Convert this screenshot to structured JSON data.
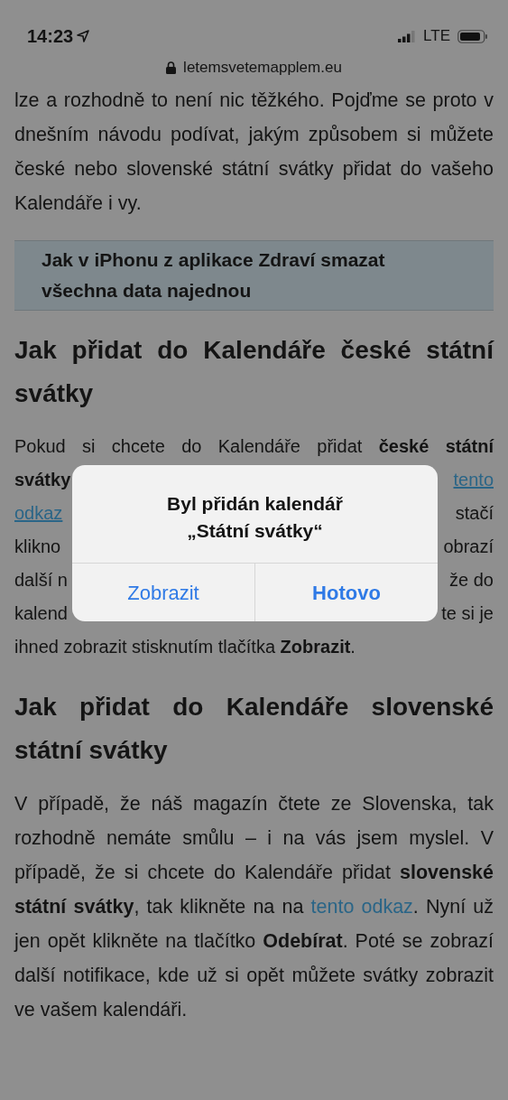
{
  "status_bar": {
    "time": "14:23",
    "network": "LTE"
  },
  "address_bar": {
    "url": "letemsvetemapplem.eu"
  },
  "article": {
    "intro": "lze a rozhodně to není nic těžkého. Pojďme se proto v dnešním návodu podívat, jakým způsobem si můžete české nebo slovenské státní svátky přidat do vašeho Kalendáře i vy.",
    "related_link": "Jak v iPhonu z aplikace Zdraví smazat všechna data najednou",
    "heading_1": "Jak přidat do Kalendáře české státní svátky",
    "covered_paragraph_lines": [
      {
        "left": [
          {
            "kind": "text",
            "text": "Pokud si chcete do Kalendáře přidat **české státní**"
          }
        ]
      },
      {
        "left": [
          {
            "kind": "text",
            "text": "**svátky**"
          }
        ],
        "right": [
          {
            "kind": "link",
            "text": "tento"
          }
        ]
      },
      {
        "left": [
          {
            "kind": "link",
            "text": "odkaz"
          }
        ],
        "right": [
          {
            "kind": "text",
            "text": "stačí"
          }
        ]
      },
      {
        "left": [
          {
            "kind": "text",
            "text": "klikno"
          }
        ],
        "right": [
          {
            "kind": "text",
            "text": "obrazí"
          }
        ]
      },
      {
        "left": [
          {
            "kind": "text",
            "text": "další n"
          }
        ],
        "right": [
          {
            "kind": "text",
            "text": "že do"
          }
        ]
      },
      {
        "left": [
          {
            "kind": "text",
            "text": "kalend"
          }
        ],
        "right": [
          {
            "kind": "text",
            "text": "te si je"
          }
        ]
      },
      {
        "left": [
          {
            "kind": "text",
            "text": "ihned zobrazit stisknutím tlačítka **Zobrazit**."
          }
        ]
      }
    ],
    "heading_2": "Jak přidat do Kalendáře slovenské státní svátky",
    "paragraph_2": [
      {
        "kind": "text",
        "text": "V případě, že náš magazín čtete ze Slovenska, tak rozhodně nemáte smůlu – i na vás jsem myslel. V případě, že si chcete do Kalendáře přidat **slovenské státní svátky**, tak klikněte na na "
      },
      {
        "kind": "link",
        "text": "tento odkaz"
      },
      {
        "kind": "text",
        "text": ". Nyní už jen opět klikněte na tlačítko **Odebírat**. Poté se zobrazí další notifikace, kde už si opět můžete svátky zobrazit ve vašem kalendáři."
      }
    ]
  },
  "alert": {
    "title": "Byl přidán kalendář „Státní svátky“",
    "buttons": [
      {
        "label": "Zobrazit",
        "default": false
      },
      {
        "label": "Hotovo",
        "default": true
      }
    ]
  }
}
